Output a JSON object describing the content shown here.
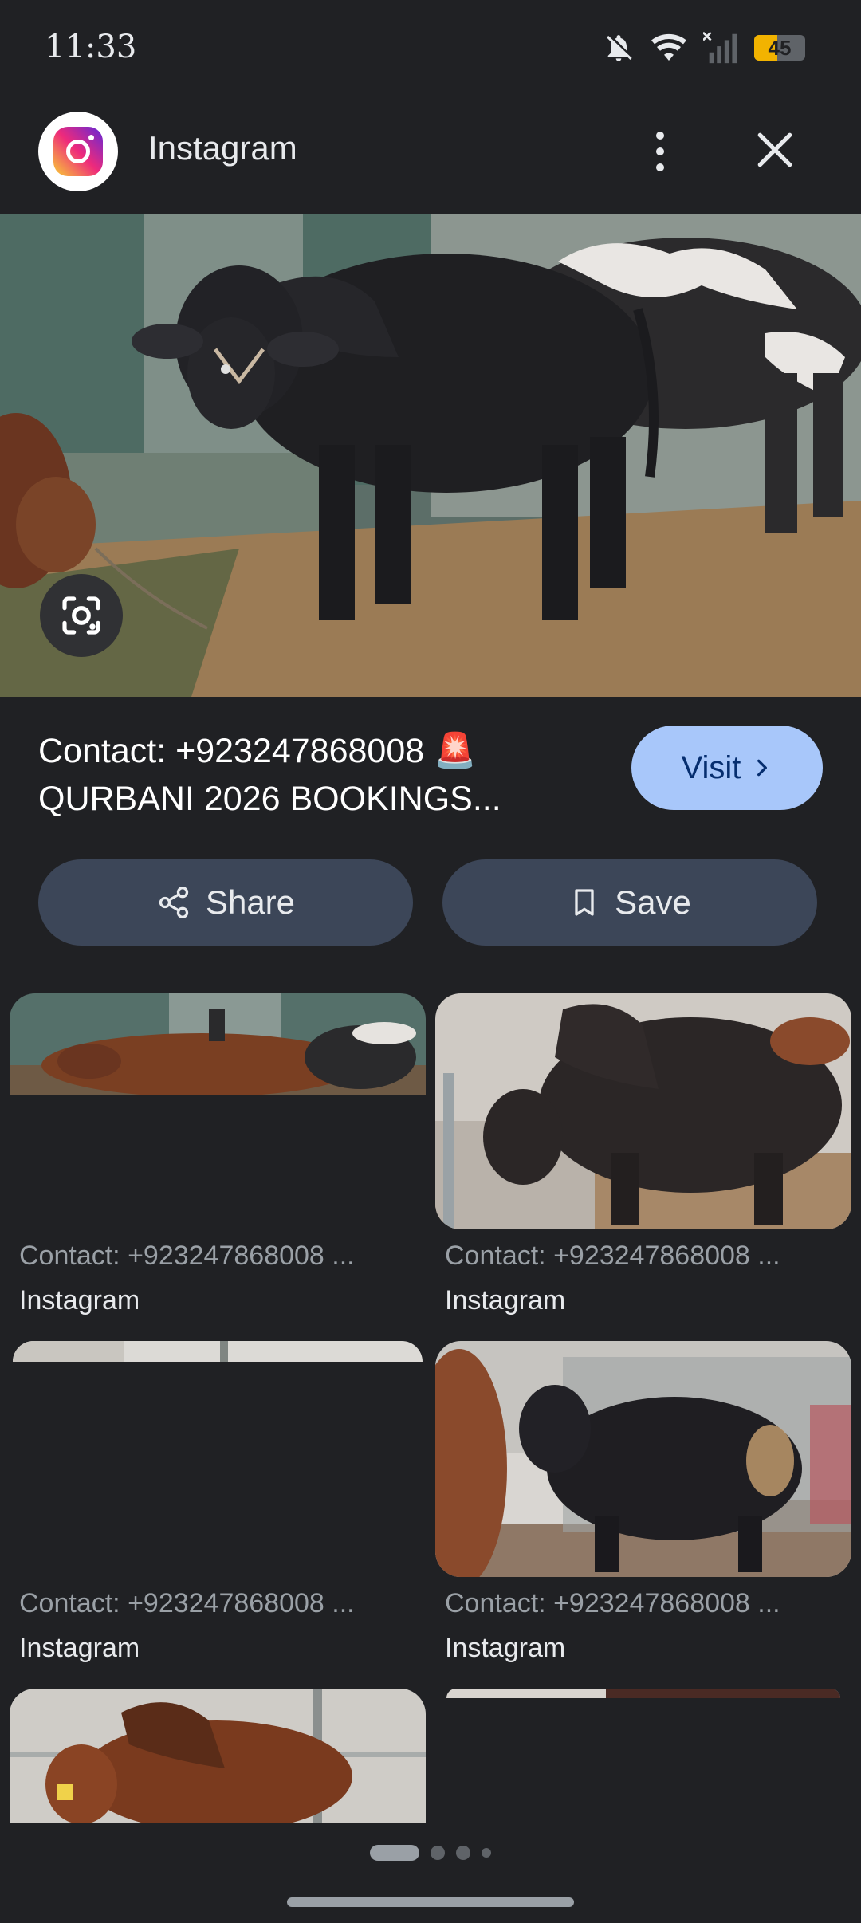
{
  "status_bar": {
    "time": "11:33",
    "battery_level": "45",
    "icons": [
      "bell-off-icon",
      "wifi-icon",
      "signal-off-icon",
      "battery-icon"
    ]
  },
  "header": {
    "app_name": "Instagram",
    "logo_icon": "instagram-logo-icon",
    "more_icon": "more-vert-icon",
    "close_icon": "close-icon"
  },
  "result": {
    "title_line1": "Contact: +923247868008 🚨",
    "title_line2": "QURBANI 2026 BOOKINGS...",
    "visit_label": "Visit",
    "share_label": "Share",
    "save_label": "Save"
  },
  "related": [
    {
      "caption": "Contact: +923247868008 ...",
      "source": "Instagram"
    },
    {
      "caption": "Contact: +923247868008 ...",
      "source": "Instagram"
    },
    {
      "caption": "Contact: +923247868008 ...",
      "source": "Instagram"
    },
    {
      "caption": "Contact: +923247868008 ...",
      "source": "Instagram"
    }
  ],
  "pager": {
    "pages": 4,
    "active_index": 0
  },
  "colors": {
    "background": "#202124",
    "accent_button": "#a8c7fa",
    "secondary_button": "#3c4658",
    "battery": "#f2b300"
  }
}
